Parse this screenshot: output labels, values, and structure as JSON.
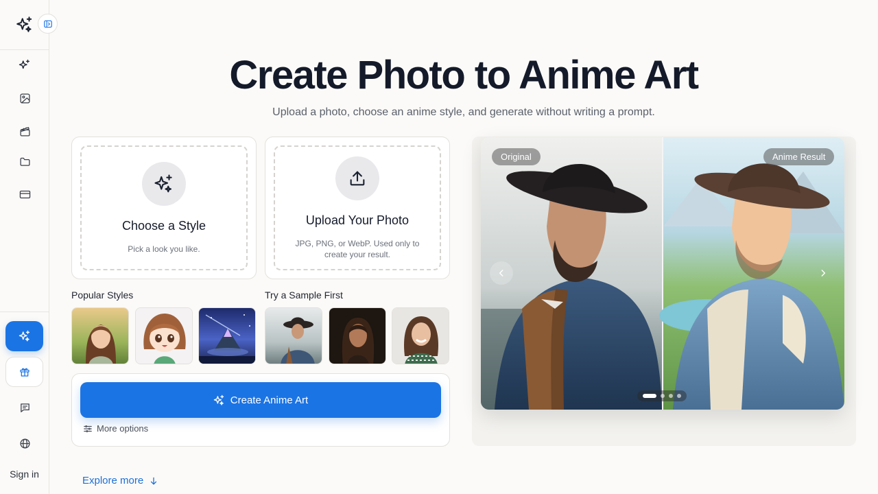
{
  "sidebar": {
    "signin_label": "Sign in"
  },
  "hero": {
    "title": "Create Photo to Anime Art",
    "subtitle": "Upload a photo, choose an anime style, and generate without writing a prompt."
  },
  "style_card": {
    "title": "Choose a Style",
    "desc": "Pick a look you like."
  },
  "upload_card": {
    "title": "Upload Your Photo",
    "desc": "JPG, PNG, or WebP. Used only to create your result."
  },
  "popular_styles": {
    "label": "Popular Styles"
  },
  "samples": {
    "label": "Try a Sample First"
  },
  "actions": {
    "create_label": "Create Anime Art",
    "more_options_label": "More options"
  },
  "explore_label": "Explore more",
  "preview": {
    "original_label": "Original",
    "result_label": "Anime Result",
    "slide_count": 4,
    "active_slide": 1
  },
  "colors": {
    "primary": "#1b74e4",
    "background": "#fbfaf8"
  }
}
